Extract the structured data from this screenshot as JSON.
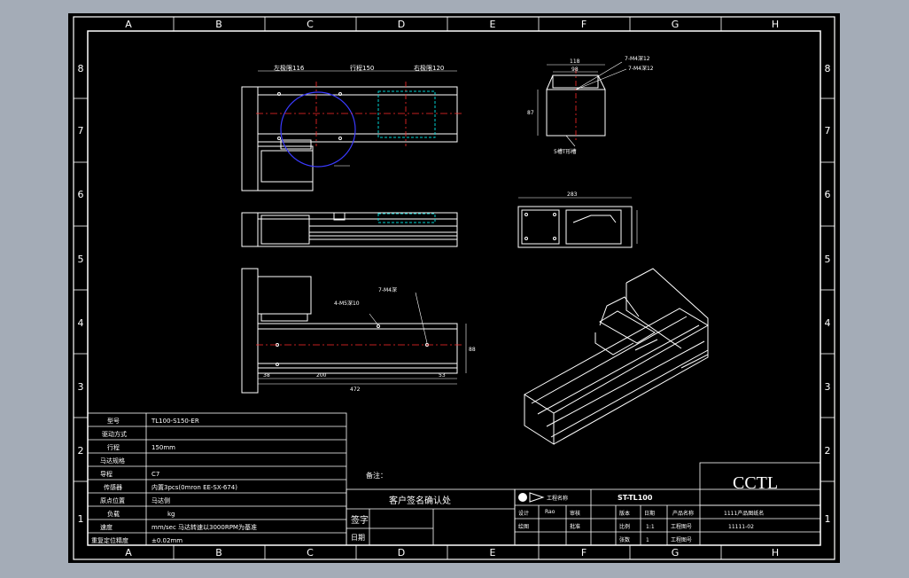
{
  "colors": {
    "background": "#a4acb7",
    "sheet": "#000000",
    "line": "#ffffff",
    "centerline": "#ff2a2a",
    "highlight_circle": "#3a3aff",
    "hidden": "#00d0d0"
  },
  "grid": {
    "columns": [
      "A",
      "B",
      "C",
      "D",
      "E",
      "F",
      "G",
      "H"
    ],
    "rows": [
      "8",
      "7",
      "6",
      "5",
      "4",
      "3",
      "2",
      "1"
    ]
  },
  "top_view": {
    "dim_left": "左极限116",
    "dim_stroke": "行程150",
    "dim_right": "右极限120"
  },
  "section_view": {
    "dim_top": "118",
    "dim_inner": "98",
    "dim_side": "87",
    "note_holes": "7-M4深12",
    "note_groove": "5槽T形槽"
  },
  "end_view": {
    "dim_width": "283"
  },
  "bottom_view": {
    "note_a": "4-M5深10",
    "note_b": "7-M4深",
    "dim_height": "88",
    "dim_1": "38",
    "dim_2": "200",
    "dim_3": "53",
    "dim_total": "472"
  },
  "notes_label": "备注：",
  "spec_table": {
    "rows": [
      {
        "label": "型号",
        "value": "TL100-S150-ER"
      },
      {
        "label": "驱动方式",
        "value": ""
      },
      {
        "label": "行程",
        "value": "150mm"
      },
      {
        "label": "马达规格",
        "value": ""
      },
      {
        "label": "导程",
        "value": "C7"
      },
      {
        "label": "传感器",
        "value": "内置3pcs(0mron EE-SX-674)"
      },
      {
        "label": "原点位置",
        "value": "马达侧"
      },
      {
        "label": "负载",
        "value": "kg"
      },
      {
        "label": "速度",
        "value": "mm/sec 马达转速以3000RPM为基准"
      },
      {
        "label": "重复定位精度",
        "value": "±0.02mm"
      }
    ]
  },
  "confirm_block": {
    "title": "客户签名确认处",
    "sign_label": "签字",
    "date_label": "日期"
  },
  "title_block": {
    "logo_text": "工程名称",
    "drawing_no": "ST-TL100",
    "company": "CCTL",
    "product_name": "1111产品图纸名",
    "code": "11111-02",
    "cells": {
      "design": "设计",
      "designer": "Rao",
      "check": "审核",
      "check_val": "",
      "approve": "批准",
      "version": "版本",
      "scale_label": "比例",
      "scale": "1:1",
      "sheet_label": "张数",
      "sheet": "1",
      "date": "日期",
      "type": "工程图号",
      "drawn": "绘图",
      "count_label": "张数",
      "product_label": "产品名称",
      "code_label": "工程图号"
    }
  }
}
